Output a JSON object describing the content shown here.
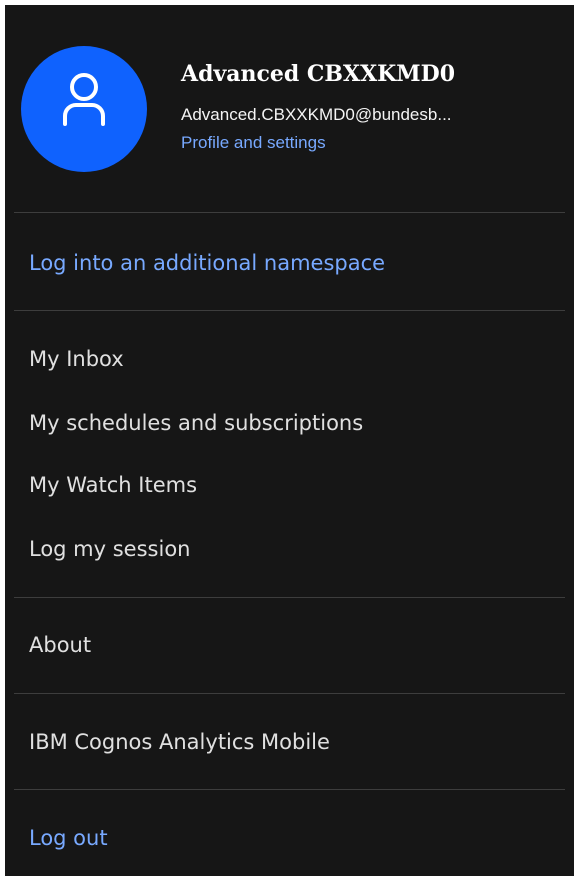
{
  "profile": {
    "icon": "user-icon",
    "avatar_color": "#0f62fe",
    "name": "Advanced CBXXKMD0",
    "email": "Advanced.CBXXKMD0@bundesb...",
    "settings_link": "Profile and settings"
  },
  "menu": {
    "namespace_link": "Log into an additional namespace",
    "inbox": "My Inbox",
    "schedules": "My schedules and subscriptions",
    "watch_items": "My Watch Items",
    "log_session": "Log my session",
    "about": "About",
    "mobile": "IBM Cognos Analytics Mobile",
    "logout": "Log out"
  },
  "colors": {
    "background": "#161616",
    "link": "#78a9ff",
    "text": "#e0e0e0",
    "divider": "#3d3d3d"
  }
}
